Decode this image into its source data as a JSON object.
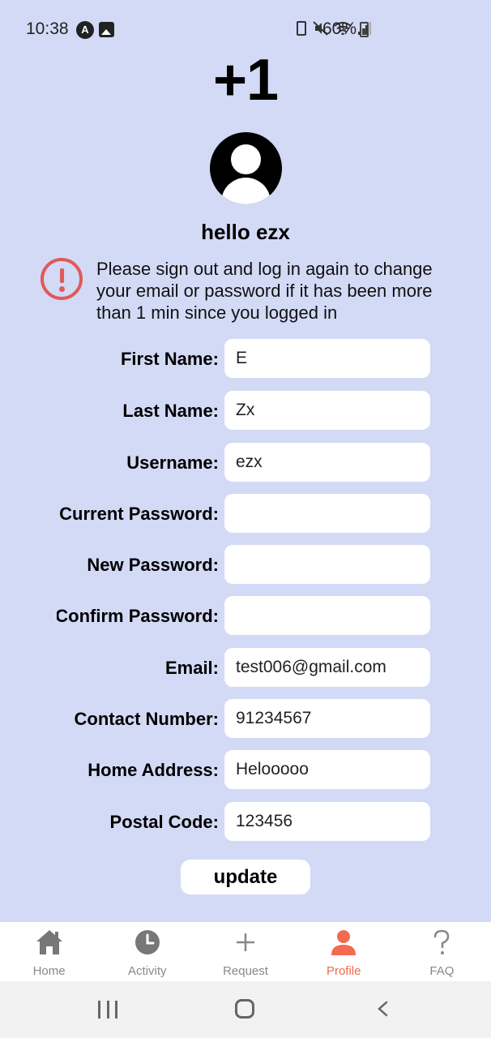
{
  "status_bar": {
    "time": "10:38",
    "battery_percent": "60%",
    "app_icon_letter": "A",
    "icons": [
      "app-notification-icon",
      "image-notification-icon",
      "battery-saver-icon",
      "mute-icon",
      "wifi-icon",
      "signal-icon",
      "battery-icon"
    ]
  },
  "header": {
    "points": "+1",
    "greeting": "hello ezx"
  },
  "notice": {
    "text": "Please sign out and log in again to change your email or password if it has been more than 1 min since you logged in",
    "icon": "alert-circle-icon",
    "color": "#e05a5a"
  },
  "form": {
    "fields": [
      {
        "label": "First Name:",
        "value": "E"
      },
      {
        "label": "Last Name:",
        "value": "Zx"
      },
      {
        "label": "Username:",
        "value": "ezx"
      },
      {
        "label": "Current Password:",
        "value": ""
      },
      {
        "label": "New Password:",
        "value": ""
      },
      {
        "label": "Confirm Password:",
        "value": ""
      },
      {
        "label": "Email:",
        "value": "test006@gmail.com"
      },
      {
        "label": "Contact Number:",
        "value": "91234567"
      },
      {
        "label": "Home Address:",
        "value": "Helooooo"
      },
      {
        "label": "Postal Code:",
        "value": "123456"
      }
    ],
    "update_label": "update"
  },
  "nav": {
    "items": [
      {
        "label": "Home",
        "icon": "home-icon"
      },
      {
        "label": "Activity",
        "icon": "clock-icon"
      },
      {
        "label": "Request",
        "icon": "plus-icon"
      },
      {
        "label": "Profile",
        "icon": "person-icon"
      },
      {
        "label": "FAQ",
        "icon": "question-icon"
      }
    ],
    "active": "Profile",
    "active_color": "#f26a4f"
  },
  "colors": {
    "background": "#d3daf5",
    "nav_inactive": "#888888"
  }
}
